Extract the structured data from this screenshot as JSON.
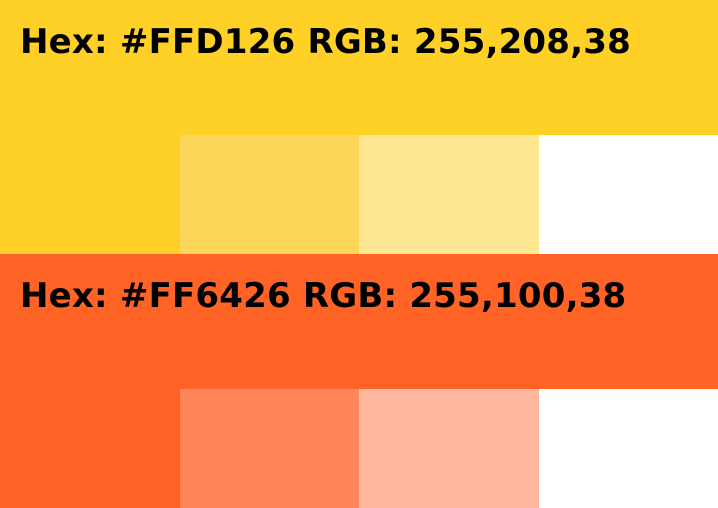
{
  "palettes": [
    {
      "label": "Hex: #FFD126 RGB: 255,208,38",
      "base_color": "#FFD126",
      "tints": [
        "#FFD126",
        "#FCD658",
        "#FFE792",
        "#FFFFFF"
      ]
    },
    {
      "label": "Hex: #FF6426 RGB: 255,100,38",
      "base_color": "#FF6426",
      "tints": [
        "#FF6426",
        "#FF8659",
        "#FFB89D",
        "#FFFFFF"
      ]
    }
  ]
}
